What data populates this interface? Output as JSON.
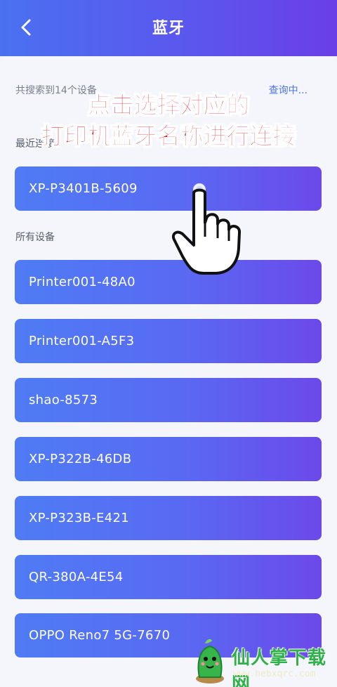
{
  "header": {
    "title": "蓝牙"
  },
  "search": {
    "count_text": "共搜索到14个设备",
    "status": "查询中..."
  },
  "sections": {
    "recent": "最近连接",
    "all": "所有设备"
  },
  "recent_devices": [
    "XP-P3401B-5609"
  ],
  "all_devices": [
    "Printer001-48A0",
    "Printer001-A5F3",
    "shao-8573",
    "XP-P322B-46DB",
    "XP-P323B-E421",
    "QR-380A-4E54",
    "OPPO Reno7 5G-7670"
  ],
  "annotation": {
    "line1": "点击选择对应的",
    "line2": "打印机蓝牙名称进行连接"
  },
  "watermark": {
    "title": "仙人掌下载网",
    "url": "www.hebxqrc.com"
  },
  "colors": {
    "accent": "#5969f2",
    "annotation": "#f0141e",
    "watermark": "#2fb14a"
  },
  "icons": {
    "back": "chevron-left-icon",
    "hand": "pointing-hand-icon",
    "logo": "cactus-logo-icon"
  }
}
